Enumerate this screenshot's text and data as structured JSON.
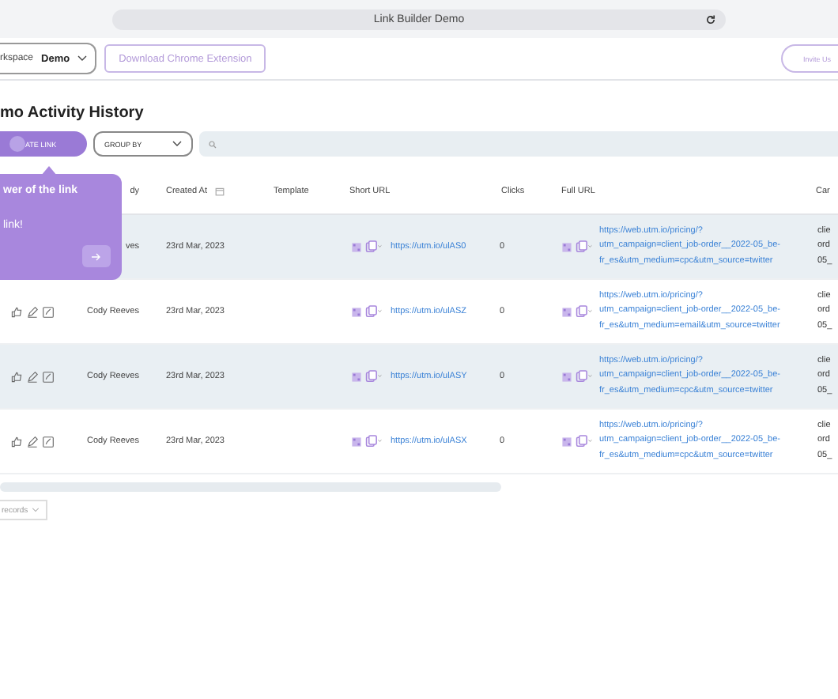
{
  "browser": {
    "title": "Link Builder Demo"
  },
  "header": {
    "workspace_label": "rkspace",
    "workspace_value": "Demo",
    "download_button": "Download Chrome Extension",
    "invite_button": "Invite Us"
  },
  "page_title": "mo Activity History",
  "toolbar": {
    "create_button": "ATE LINK",
    "group_by": "GROUP BY"
  },
  "popover": {
    "title": "wer of the link",
    "body": "link!"
  },
  "table": {
    "columns": [
      "dy",
      "Created At",
      "Template",
      "Short URL",
      "Clicks",
      "Full URL",
      "Car"
    ],
    "rows": [
      {
        "created_by": "ves",
        "created_at": "23rd Mar, 2023",
        "short_url": "https://utm.io/ulAS0",
        "clicks": "0",
        "full_url": "https://web.utm.io/pricing/? utm_campaign=client_job-order__2022-05_be-fr_es&utm_medium=cpc&utm_source=twitter",
        "campaign": "clie ord 05_"
      },
      {
        "created_by": "Cody Reeves",
        "created_at": "23rd Mar, 2023",
        "short_url": "https://utm.io/ulASZ",
        "clicks": "0",
        "full_url": "https://web.utm.io/pricing/? utm_campaign=client_job-order__2022-05_be-fr_es&utm_medium=email&utm_source=twitter",
        "campaign": "clie ord 05_"
      },
      {
        "created_by": "Cody Reeves",
        "created_at": "23rd Mar, 2023",
        "short_url": "https://utm.io/ulASY",
        "clicks": "0",
        "full_url": "https://web.utm.io/pricing/? utm_campaign=client_job-order__2022-05_be-fr_es&utm_medium=cpc&utm_source=twitter",
        "campaign": "clie ord 05_"
      },
      {
        "created_by": "Cody Reeves",
        "created_at": "23rd Mar, 2023",
        "short_url": "https://utm.io/ulASX",
        "clicks": "0",
        "full_url": "https://web.utm.io/pricing/? utm_campaign=client_job-order__2022-05_be-fr_es&utm_medium=cpc&utm_source=twitter",
        "campaign": "clie ord 05_"
      }
    ]
  },
  "pagination": {
    "records": "records"
  }
}
